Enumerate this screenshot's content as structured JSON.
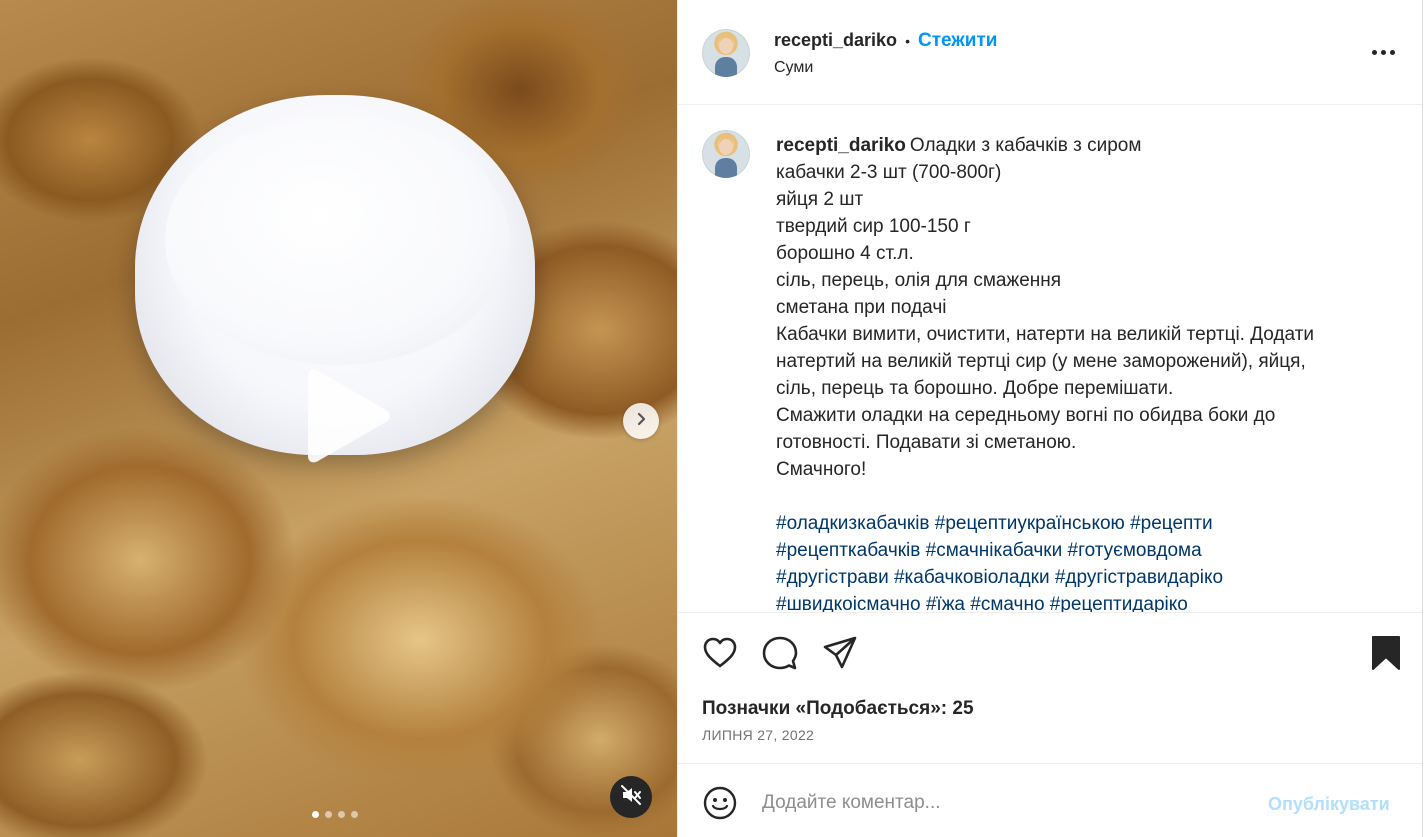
{
  "post": {
    "username": "recepti_dariko",
    "follow_label": "Стежити",
    "separator": "•",
    "location": "Суми"
  },
  "caption": {
    "username": "recepti_dariko",
    "lines": [
      "Оладки з кабачків з сиром",
      "кабачки 2-3 шт (700-800г)",
      "яйця 2 шт",
      "твердий сир 100-150 г",
      "борошно 4 ст.л.",
      "сіль, перець, олія для смаження",
      "сметана при подачі",
      "Кабачки вимити, очистити, натерти на великій тертці. Додати",
      "натертий на великій тертці сир (у мене заморожений), яйця,",
      "сіль, перець та борошно. Добре перемішати.",
      "Смажити оладки на середньому вогні по обидва боки до",
      "готовності. Подавати зі сметаною.",
      "Смачного!"
    ],
    "hashtag_lines": [
      "#оладкизкабачків #рецептиукраїнською #рецепти",
      "#рецепткабачків #смачнікабачки #готуємовдома",
      "#другістрави #кабачковіоладки #другістравидаріко",
      "#швидкоісмачно #їжа #смачно #рецептидаріко"
    ]
  },
  "engagement": {
    "likes_label": "Позначки «Подобається»: 25",
    "date": "ЛИПНЯ 27, 2022"
  },
  "comment": {
    "placeholder": "Додайте коментар...",
    "publish_label": "Опублікувати"
  },
  "media": {
    "slide_count": 4,
    "active_slide": 1
  },
  "colors": {
    "accent": "#0095f6",
    "hashtag": "#00376b",
    "publish_disabled": "#b2dffc",
    "muted_text": "#737373"
  },
  "icons": [
    "play-icon",
    "chevron-right-icon",
    "mute-icon",
    "more-icon",
    "heart-icon",
    "comment-icon",
    "share-icon",
    "bookmark-icon",
    "emoji-icon"
  ]
}
